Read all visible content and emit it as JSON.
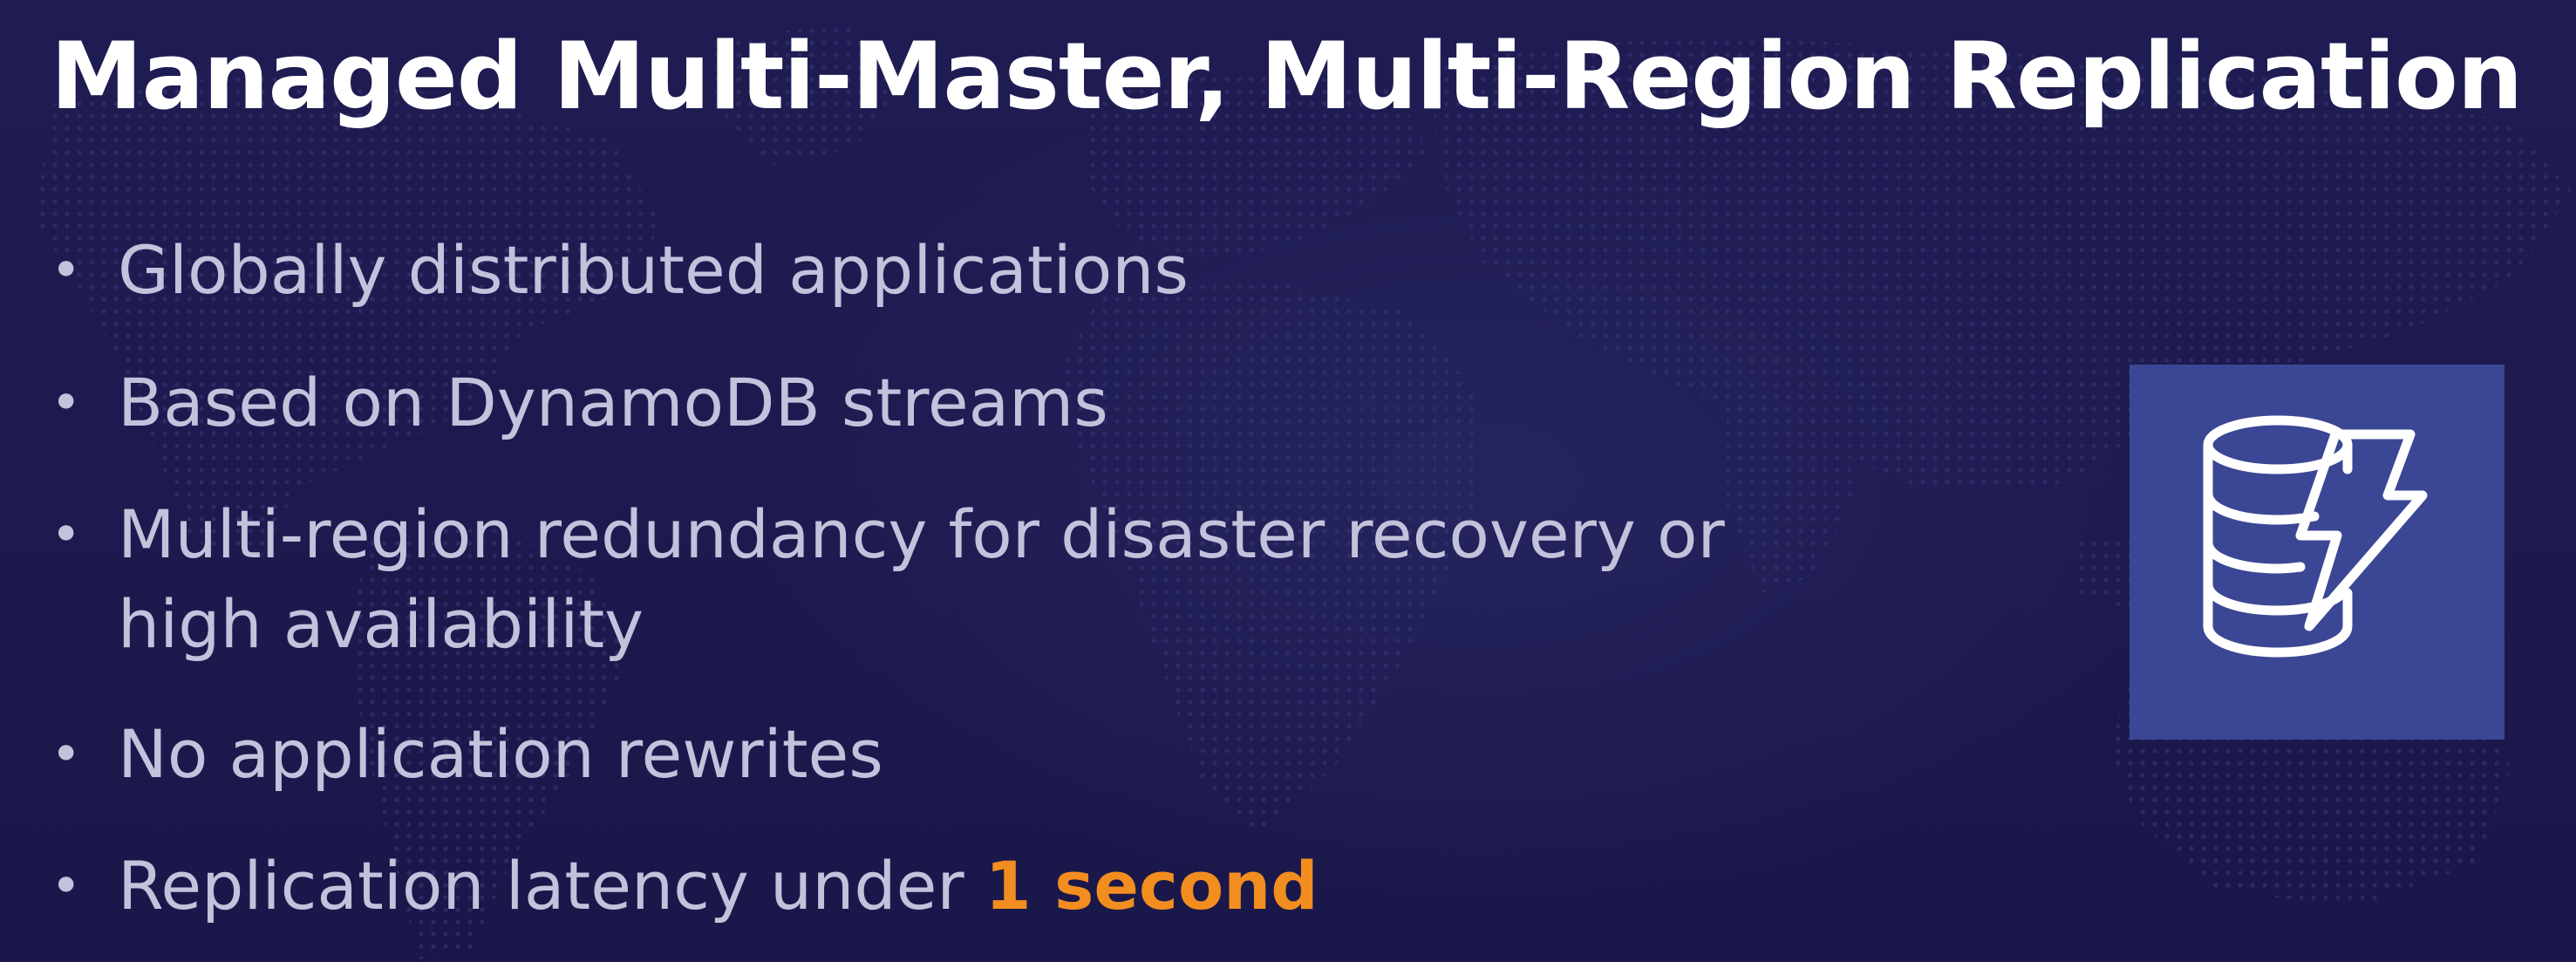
{
  "slide": {
    "title": "Managed Multi-Master, Multi-Region Replication",
    "bullets": [
      {
        "text": "Globally distributed applications"
      },
      {
        "text": "Based on DynamoDB streams"
      },
      {
        "text": "Multi-region redundancy for disaster recovery or",
        "text_line2": "high availability"
      },
      {
        "text": "No application rewrites"
      },
      {
        "text": "Replication latency under ",
        "highlight": "1 second"
      }
    ],
    "bullet_glyph": "•",
    "icon": {
      "name": "dynamodb-database-lightning-icon"
    }
  },
  "colors": {
    "background": "#1c1a4f",
    "title": "#ffffff",
    "bullet_text": "#c3c2dc",
    "highlight": "#f28d1f",
    "icon_box": "#3b4794"
  }
}
